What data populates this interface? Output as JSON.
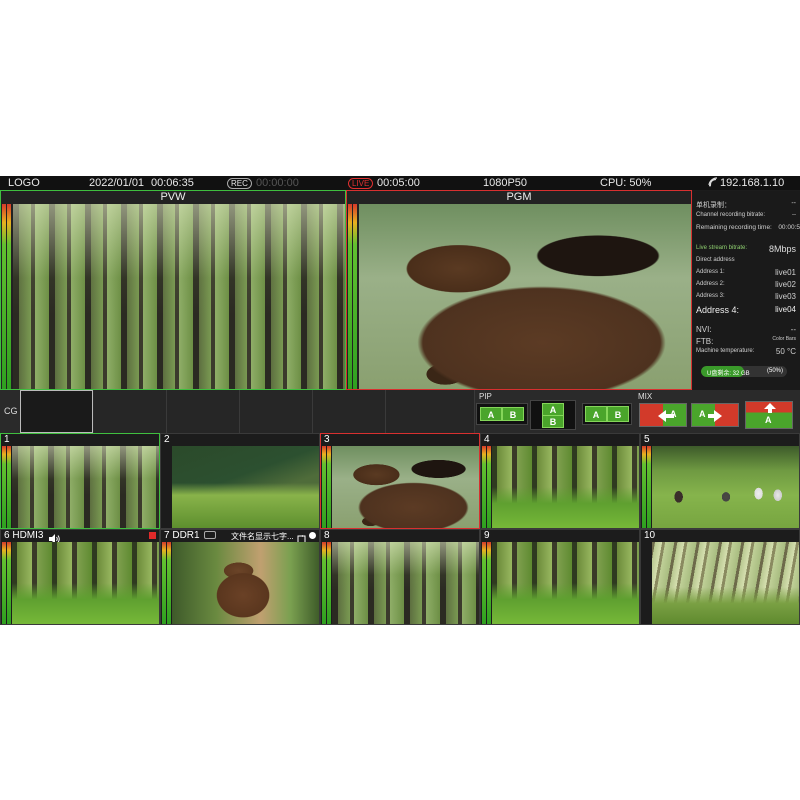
{
  "topbar": {
    "logo": "LOGO",
    "date": "2022/01/01",
    "time": "00:06:35",
    "rec_badge": "REC",
    "rec_time": "00:00:00",
    "live_badge": "LIVE",
    "live_time": "00:05:00",
    "format": "1080P50",
    "cpu": "CPU: 50%",
    "ip": "192.168.1.10"
  },
  "monitors": {
    "pvw_label": "PVW",
    "pgm_label": "PGM"
  },
  "info": {
    "row1_label": "单机录制：",
    "row1_value": "--",
    "row2_label": "Channel recording bitrate:",
    "row2_value": "--",
    "row3_label": "Remaining recording time:",
    "row3_value": "00:00:5",
    "row4_label": "Live stream bitrate:",
    "row4_value": "8Mbps",
    "row5_label": "Direct address",
    "addr1_label": "Address 1:",
    "addr1_value": "live01",
    "addr2_label": "Address 2:",
    "addr2_value": "live02",
    "addr3_label": "Address 3:",
    "addr3_value": "live03",
    "addr4_label": "Address 4:",
    "addr4_value": "live04",
    "nvi_label": "NVI:",
    "nvi_value": "--",
    "ftb_label": "FTB:",
    "ftb_value": "Color Bars",
    "temp_label": "Machine temperature:",
    "temp_value": "50 °C",
    "storage_text": "U盘剩余: 32 GB",
    "storage_pct_label": "(50%)",
    "storage_fraction": 0.5
  },
  "cg": {
    "label": "CG"
  },
  "pip": {
    "label": "PIP",
    "a": "A",
    "b": "B"
  },
  "mix": {
    "label": "MIX",
    "a": "A"
  },
  "sources": [
    {
      "num": "1",
      "name": ""
    },
    {
      "num": "2",
      "name": ""
    },
    {
      "num": "3",
      "name": ""
    },
    {
      "num": "4",
      "name": ""
    },
    {
      "num": "5",
      "name": ""
    },
    {
      "num": "6",
      "name": "HDMI3"
    },
    {
      "num": "7",
      "name": "DDR1"
    },
    {
      "num": "8",
      "name": ""
    },
    {
      "num": "9",
      "name": ""
    },
    {
      "num": "10",
      "name": ""
    }
  ],
  "ddr_filename": "文件名显示七字...",
  "colors": {
    "pvw_border": "#3fbf3f",
    "pgm_border": "#d83030",
    "button_green": "#4aa52b",
    "button_red": "#d23a2a"
  },
  "icons": {
    "wifi": "wifi-icon",
    "speaker": "speaker-icon",
    "record_square": "record-square-icon",
    "loop": "loop-icon",
    "play_dot": "play-dot-icon"
  }
}
